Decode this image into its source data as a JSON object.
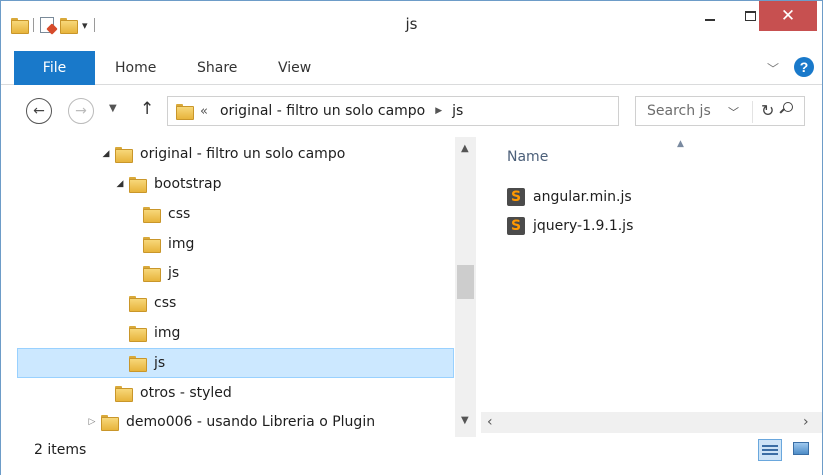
{
  "window": {
    "title": "js",
    "close_symbol": "✕"
  },
  "ribbon": {
    "tabs": [
      "File",
      "Home",
      "Share",
      "View"
    ]
  },
  "address": {
    "overflow": "«",
    "segments": [
      "original - filtro un solo campo",
      "js"
    ]
  },
  "search": {
    "placeholder": "Search js"
  },
  "tree": {
    "items": [
      {
        "label": "original - filtro un solo campo",
        "level": 0,
        "expander": "expanded"
      },
      {
        "label": "bootstrap",
        "level": 1,
        "expander": "expanded"
      },
      {
        "label": "css",
        "level": 2,
        "expander": "none"
      },
      {
        "label": "img",
        "level": 2,
        "expander": "none"
      },
      {
        "label": "js",
        "level": 2,
        "expander": "none"
      },
      {
        "label": "css",
        "level": 1,
        "expander": "none"
      },
      {
        "label": "img",
        "level": 1,
        "expander": "none"
      },
      {
        "label": "js",
        "level": 1,
        "expander": "none",
        "selected": true
      },
      {
        "label": "otros - styled",
        "level": 0,
        "expander": "none"
      },
      {
        "label": "demo006 - usando Libreria o Plugin",
        "level": -1,
        "expander": "collapsed"
      }
    ]
  },
  "files": {
    "column_name": "Name",
    "items": [
      {
        "name": "angular.min.js",
        "icon": "sublime-text-icon"
      },
      {
        "name": "jquery-1.9.1.js",
        "icon": "sublime-text-icon"
      }
    ]
  },
  "status": {
    "item_count": "2 items"
  },
  "colors": {
    "accent": "#1979ca",
    "close": "#c75050",
    "selection": "#cce8ff"
  }
}
